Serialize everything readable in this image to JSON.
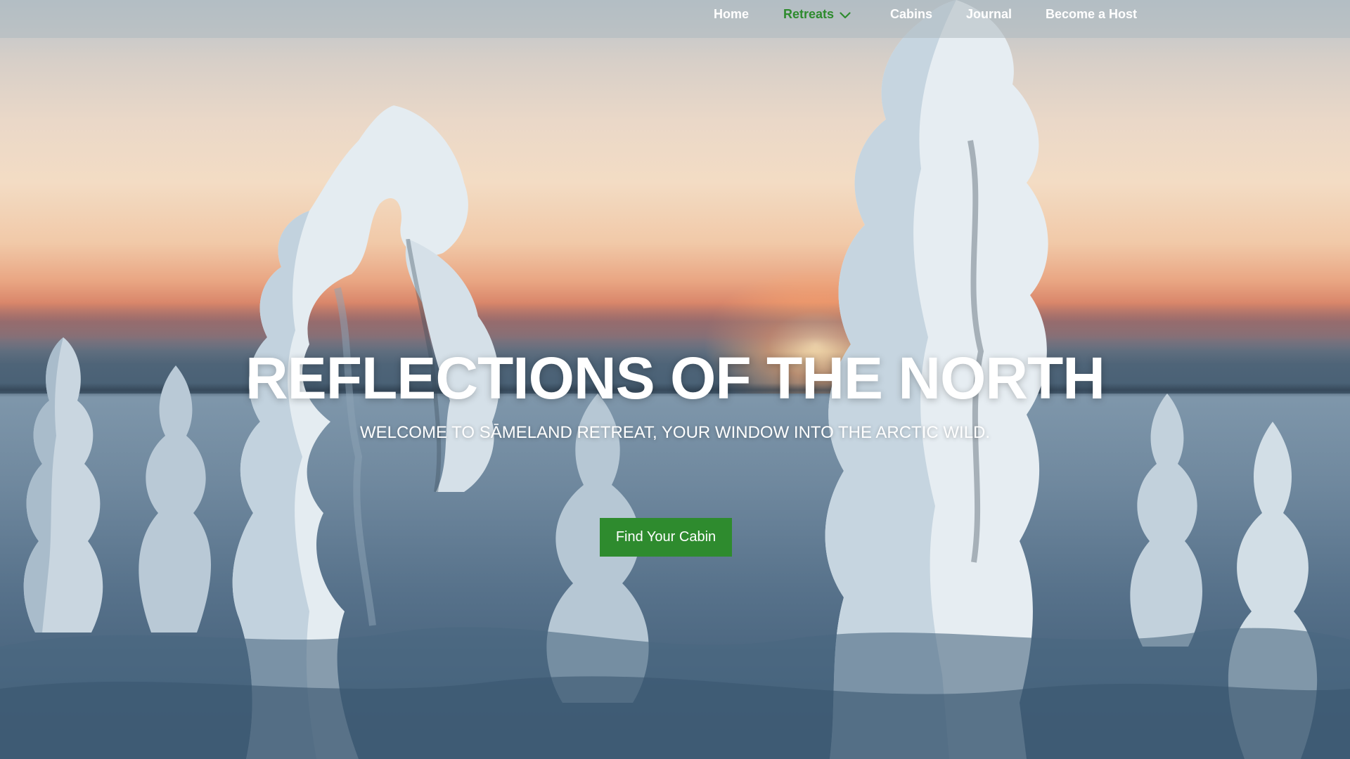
{
  "nav": {
    "items": [
      {
        "label": "Home",
        "active": false
      },
      {
        "label": "Retreats",
        "active": true,
        "has_dropdown": true
      },
      {
        "label": "Cabins",
        "active": false
      },
      {
        "label": "Journal",
        "active": false
      },
      {
        "label": "Become a Host",
        "active": false
      }
    ],
    "dropdown_icon": "chevron-down-icon"
  },
  "hero": {
    "title": "REFLECTIONS OF THE NORTH",
    "subtitle": "WELCOME TO SĀMELAND RETREAT, YOUR WINDOW INTO THE ARCTIC WILD.",
    "cta_label": "Find Your Cabin",
    "background": "snow-covered-trees-arctic-sunset-photo"
  },
  "colors": {
    "accent": "#2e8b2e",
    "nav_text": "#ffffff",
    "navbar_bg": "#afb9c0"
  }
}
